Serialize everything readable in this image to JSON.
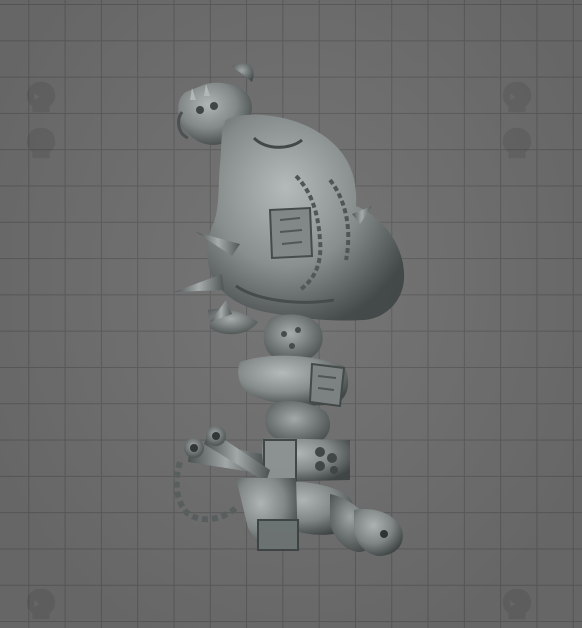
{
  "viewer": {
    "background_color": "#6f6f6f",
    "grid_color": "#5b5b5b",
    "model_color": "#8a9190",
    "model_shadow": "#3c4242",
    "model_highlight": "#aeb5b4"
  },
  "watermarks": [
    {
      "icon": "skull-logo-icon"
    },
    {
      "icon": "skull-logo-icon"
    },
    {
      "icon": "skull-logo-icon"
    },
    {
      "icon": "skull-logo-icon"
    },
    {
      "icon": "skull-logo-icon"
    },
    {
      "icon": "skull-logo-icon"
    }
  ]
}
